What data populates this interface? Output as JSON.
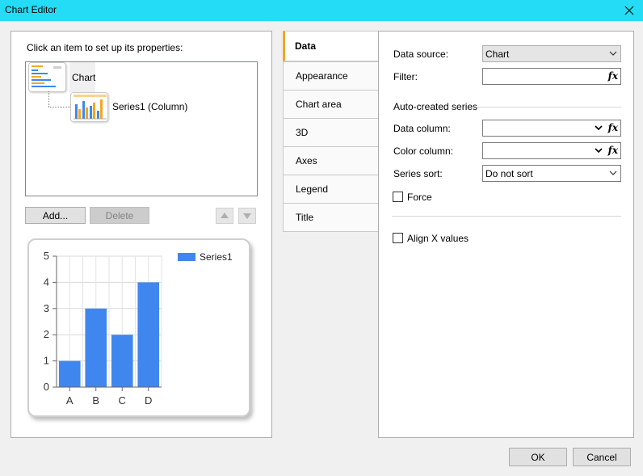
{
  "window": {
    "title": "Chart Editor"
  },
  "left": {
    "hint": "Click an item to set up its properties:",
    "tree": [
      {
        "label": "Chart"
      },
      {
        "label": "Series1 (Column)"
      }
    ],
    "buttons": {
      "add": "Add...",
      "delete": "Delete"
    }
  },
  "chart_data": {
    "type": "bar",
    "categories": [
      "A",
      "B",
      "C",
      "D"
    ],
    "series": [
      {
        "name": "Series1",
        "values": [
          1,
          3,
          2,
          4
        ],
        "color": "#3f87ee"
      }
    ],
    "ylim": [
      0,
      5
    ],
    "yticks": [
      "0",
      "1",
      "2",
      "3",
      "4",
      "5"
    ],
    "grid": true,
    "legend": "top-right"
  },
  "tabs": [
    "Data",
    "Appearance",
    "Chart area",
    "3D",
    "Axes",
    "Legend",
    "Title"
  ],
  "data_tab": {
    "data_source_label": "Data source:",
    "data_source_value": "Chart",
    "filter_label": "Filter:",
    "section_title": "Auto-created series",
    "data_column_label": "Data column:",
    "color_column_label": "Color column:",
    "series_sort_label": "Series sort:",
    "series_sort_value": "Do not sort",
    "force_label": "Force",
    "align_x_label": "Align X values"
  },
  "footer": {
    "ok": "OK",
    "cancel": "Cancel"
  }
}
